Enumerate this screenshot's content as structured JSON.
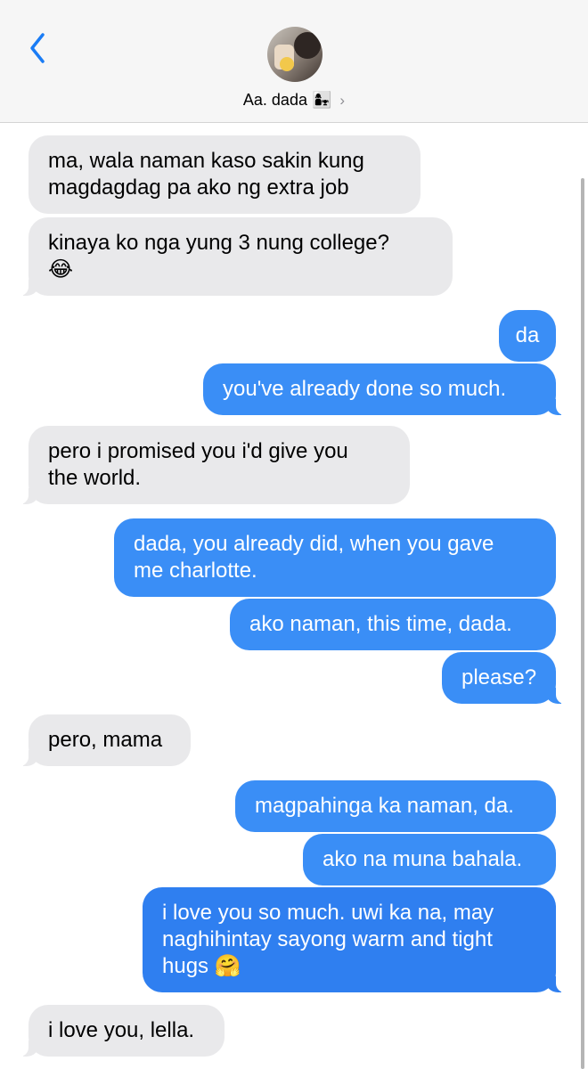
{
  "header": {
    "contact_name": "Aa. dada",
    "contact_emoji": "👩‍👧"
  },
  "messages": [
    {
      "dir": "in",
      "text": "ma, wala naman kaso sakin kung\nmagdagdag pa ako ng extra job"
    },
    {
      "dir": "in",
      "text": "kinaya ko nga yung 3 nung college?\n😂"
    },
    {
      "dir": "out",
      "text": "da"
    },
    {
      "dir": "out",
      "text": "you've already done so much."
    },
    {
      "dir": "in",
      "text": "pero i promised you i'd give you\nthe world."
    },
    {
      "dir": "out",
      "text": "dada, you already did, when you gave\nme charlotte."
    },
    {
      "dir": "out",
      "text": "ako naman, this time, dada."
    },
    {
      "dir": "out",
      "text": "please?"
    },
    {
      "dir": "in",
      "text": "pero, mama"
    },
    {
      "dir": "out",
      "text": "magpahinga ka naman, da."
    },
    {
      "dir": "out",
      "text": "ako na muna bahala."
    },
    {
      "dir": "out",
      "text": "i love you so much. uwi ka na, may\nnaghihintay sayong warm and tight\nhugs 🤗"
    },
    {
      "dir": "in",
      "text": "i love you, lella."
    }
  ],
  "colors": {
    "incoming": "#e9e9eb",
    "outgoing": "#3a8ef6",
    "accent": "#1a7cf5"
  }
}
